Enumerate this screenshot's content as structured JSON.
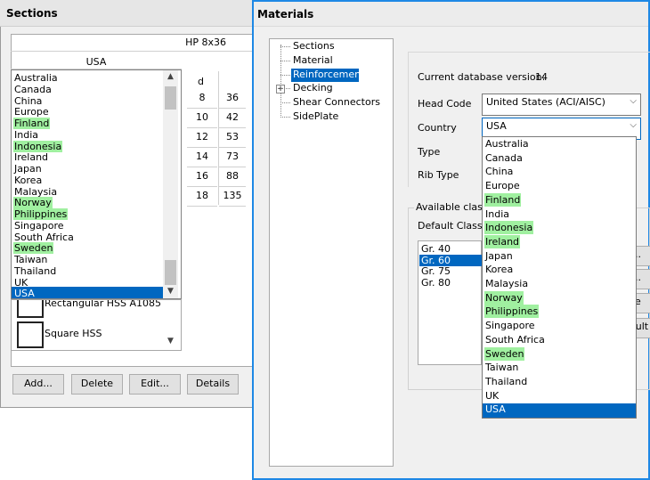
{
  "sections_window": {
    "title": "Sections",
    "table_header": "HP 8x36",
    "list_header": "USA",
    "countries": [
      "Australia",
      "Canada",
      "China",
      "Europe",
      "Finland",
      "India",
      "Indonesia",
      "Ireland",
      "Japan",
      "Korea",
      "Malaysia",
      "Norway",
      "Philippines",
      "Singapore",
      "South Africa",
      "Sweden",
      "Taiwan",
      "Thailand",
      "UK",
      "USA"
    ],
    "highlighted_countries": [
      "Finland",
      "Indonesia",
      "Norway",
      "Philippines",
      "Sweden"
    ],
    "selected_country": "USA",
    "shapes": [
      "Rectangular HSS A1085",
      "Square HSS"
    ],
    "dim_header": "d",
    "dim_rows": [
      [
        "8",
        "36"
      ],
      [
        "10",
        "42"
      ],
      [
        "12",
        "53"
      ],
      [
        "14",
        "73"
      ],
      [
        "16",
        "88"
      ],
      [
        "18",
        "135"
      ]
    ],
    "buttons": {
      "add": "Add...",
      "delete": "Delete",
      "edit": "Edit...",
      "details": "Details"
    }
  },
  "materials_window": {
    "title": "Materials",
    "tree": [
      "Sections",
      "Material",
      "Reinforcement",
      "Decking",
      "Shear Connectors",
      "SidePlate"
    ],
    "tree_selected": "Reinforcement",
    "db_version_label": "Current database version:",
    "db_version_value": "14",
    "head_code_label": "Head Code",
    "head_code_value": "United States (ACI/AISC)",
    "country_label": "Country",
    "country_value": "USA",
    "type_label": "Type",
    "rib_type_label": "Rib Type",
    "available_classes_label": "Available classes",
    "default_class_label": "Default Class",
    "classes": [
      "Gr. 40",
      "Gr. 60",
      "Gr. 75",
      "Gr. 80"
    ],
    "selected_class": "Gr. 60",
    "side_button_fragments": [
      "..",
      "..",
      "e",
      "ault"
    ]
  },
  "country_dropdown": {
    "options": [
      "Australia",
      "Canada",
      "China",
      "Europe",
      "Finland",
      "India",
      "Indonesia",
      "Ireland",
      "Japan",
      "Korea",
      "Malaysia",
      "Norway",
      "Philippines",
      "Singapore",
      "South Africa",
      "Sweden",
      "Taiwan",
      "Thailand",
      "UK",
      "USA"
    ],
    "highlighted": [
      "Finland",
      "Indonesia",
      "Ireland",
      "Norway",
      "Philippines",
      "Sweden"
    ],
    "selected": "USA"
  },
  "colors": {
    "highlight": "#a0f0a0",
    "selection": "#0067c0",
    "active_border": "#1e88e5"
  }
}
